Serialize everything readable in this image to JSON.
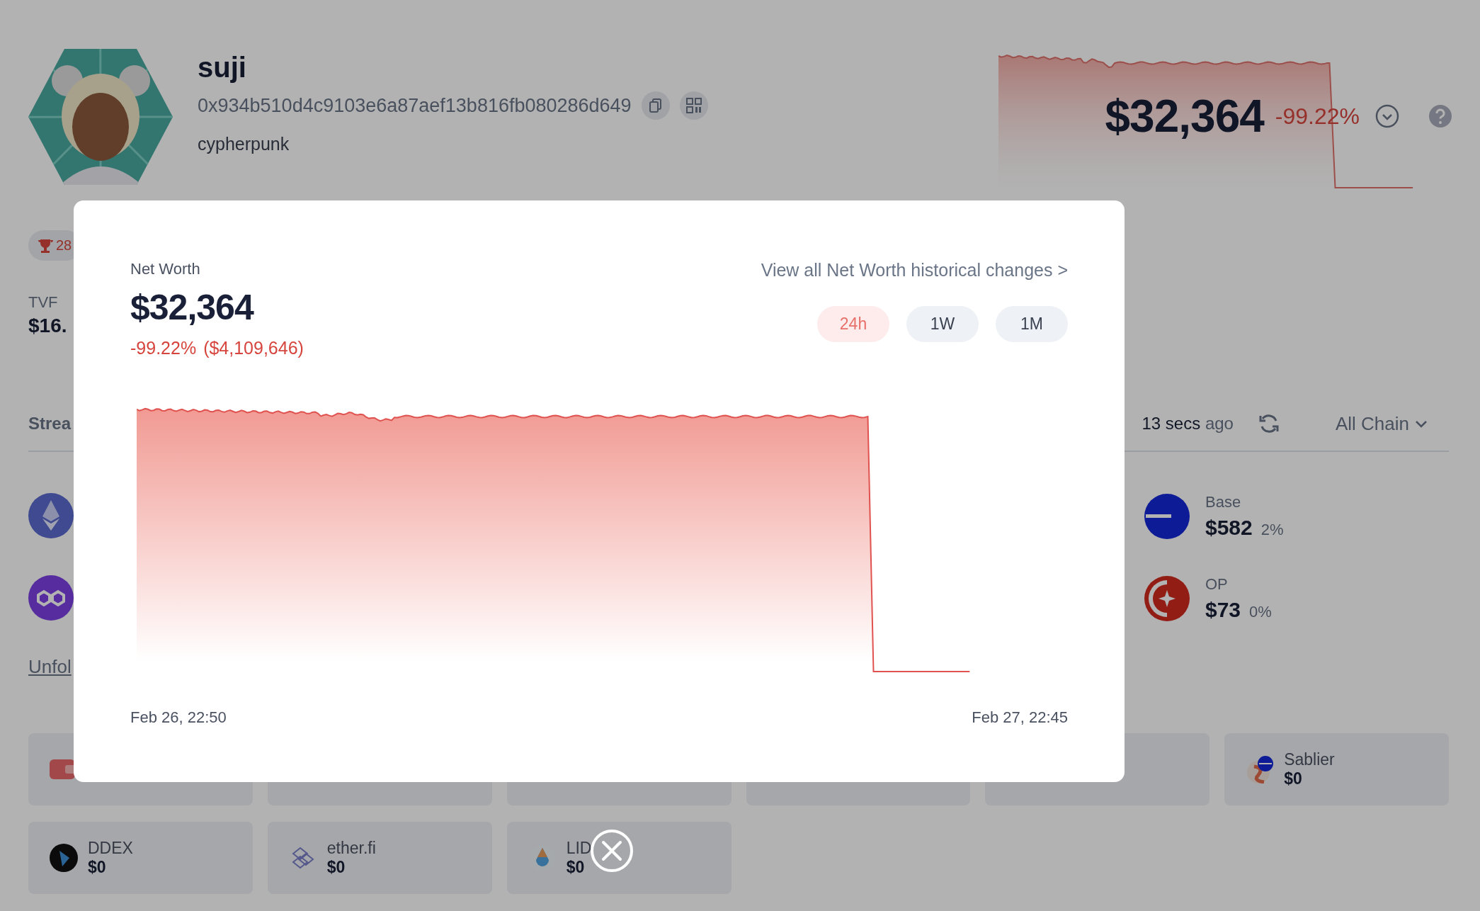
{
  "profile": {
    "name": "suji",
    "address": "0x934b510d4c9103e6a87aef13b816fb080286d649",
    "tag": "cypherpunk"
  },
  "summary": {
    "net_worth": "$32,364",
    "change": "-99.22%"
  },
  "badge": {
    "text": "28"
  },
  "tvf": {
    "label": "TVF",
    "value": "$16."
  },
  "stream": {
    "title": "Strea",
    "updated": "**13 secs** ago",
    "chain_filter": "All Chain"
  },
  "chains": [
    {
      "name": "Base",
      "value": "$582",
      "share": "2%"
    },
    {
      "name": "OP",
      "value": "$73",
      "share": "0%"
    }
  ],
  "unfold_link": "Unfol",
  "protocols": [
    {
      "name": "Sablier",
      "value": "$0"
    },
    {
      "name": "DDEX",
      "value": "$0"
    },
    {
      "name": "ether.fi",
      "value": "$0"
    },
    {
      "name": "LID",
      "value": "$0"
    }
  ],
  "modal": {
    "title": "Net Worth",
    "value": "$32,364",
    "change": "-99.22%",
    "change_amount": "($4,109,646)",
    "history_link": "View all Net Worth historical changes >",
    "ranges": [
      {
        "label": "24h",
        "selected": true
      },
      {
        "label": "1W",
        "selected": false
      },
      {
        "label": "1M",
        "selected": false
      }
    ],
    "start_label": "Feb 26, 22:50",
    "end_label": "Feb 27, 22:45"
  }
}
